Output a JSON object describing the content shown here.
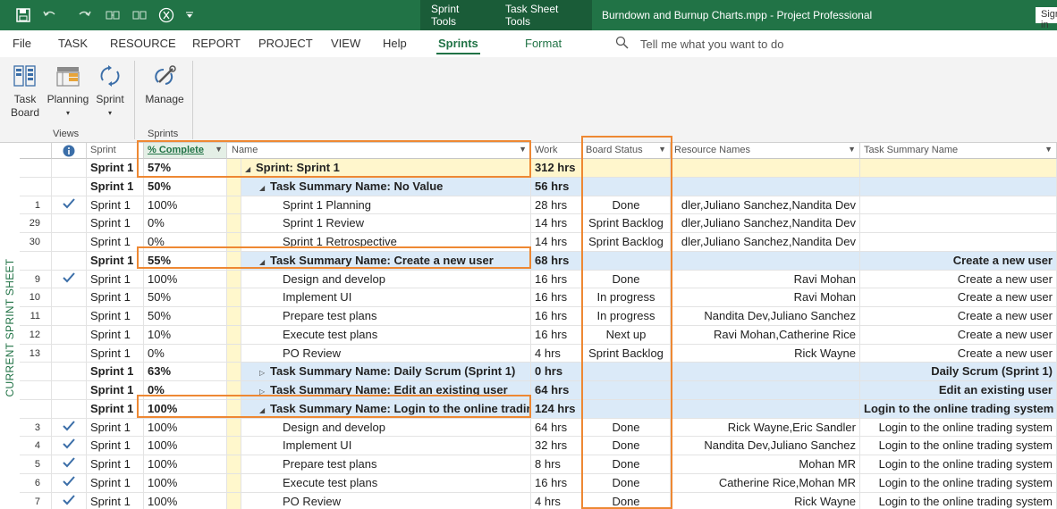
{
  "title_bar": {
    "contextual_tabs": [
      "Sprint Tools",
      "Task Sheet Tools"
    ],
    "document_title": "Burndown and Burnup Charts.mpp  -  Project Professional",
    "sign_in": "Sign in"
  },
  "ribbon_tabs": [
    "File",
    "TASK",
    "RESOURCE",
    "REPORT",
    "PROJECT",
    "VIEW",
    "Help",
    "Sprints",
    "Format"
  ],
  "tell_me": "Tell me what you want to do",
  "ribbon": {
    "views_group": {
      "label": "Views",
      "buttons": [
        "Task Board",
        "Planning",
        "Sprint"
      ]
    },
    "sprints_group": {
      "label": "Sprints",
      "buttons": [
        "Manage"
      ]
    }
  },
  "side_label": "CURRENT SPRINT SHEET",
  "columns": {
    "sprint": "Sprint",
    "pct": "% Complete",
    "name": "Name",
    "work": "Work",
    "board": "Board Status",
    "resources": "Resource Names",
    "tsn": "Task Summary Name"
  },
  "rows": [
    {
      "id": "",
      "check": false,
      "sprint": "Sprint 1",
      "pct": "57%",
      "name": "Sprint: Sprint 1",
      "work": "312 hrs",
      "board": "",
      "res": "",
      "tsn": "",
      "kind": "top",
      "tri": "◢",
      "lvl": 0
    },
    {
      "id": "",
      "check": false,
      "sprint": "Sprint 1",
      "pct": "50%",
      "name": "Task Summary Name: No Value",
      "work": "56 hrs",
      "board": "",
      "res": "",
      "tsn": "",
      "kind": "summary",
      "tri": "◢",
      "lvl": 1
    },
    {
      "id": "1",
      "check": true,
      "sprint": "Sprint 1",
      "pct": "100%",
      "name": "Sprint 1 Planning",
      "work": "28 hrs",
      "board": "Done",
      "res": "dler,Juliano Sanchez,Nandita Dev",
      "tsn": "",
      "kind": "task",
      "tri": "",
      "lvl": 2
    },
    {
      "id": "29",
      "check": false,
      "sprint": "Sprint 1",
      "pct": "0%",
      "name": "Sprint 1 Review",
      "work": "14 hrs",
      "board": "Sprint Backlog",
      "res": "dler,Juliano Sanchez,Nandita Dev",
      "tsn": "",
      "kind": "task",
      "tri": "",
      "lvl": 2
    },
    {
      "id": "30",
      "check": false,
      "sprint": "Sprint 1",
      "pct": "0%",
      "name": "Sprint 1 Retrospective",
      "work": "14 hrs",
      "board": "Sprint Backlog",
      "res": "dler,Juliano Sanchez,Nandita Dev",
      "tsn": "",
      "kind": "task",
      "tri": "",
      "lvl": 2
    },
    {
      "id": "",
      "check": false,
      "sprint": "Sprint 1",
      "pct": "55%",
      "name": "Task Summary Name: Create a new user",
      "work": "68 hrs",
      "board": "",
      "res": "",
      "tsn": "Create a new user",
      "kind": "summary",
      "tri": "◢",
      "lvl": 1
    },
    {
      "id": "9",
      "check": true,
      "sprint": "Sprint 1",
      "pct": "100%",
      "name": "Design and develop",
      "work": "16 hrs",
      "board": "Done",
      "res": "Ravi Mohan",
      "tsn": "Create a new user",
      "kind": "task",
      "tri": "",
      "lvl": 2
    },
    {
      "id": "10",
      "check": false,
      "sprint": "Sprint 1",
      "pct": "50%",
      "name": "Implement UI",
      "work": "16 hrs",
      "board": "In progress",
      "res": "Ravi Mohan",
      "tsn": "Create a new user",
      "kind": "task",
      "tri": "",
      "lvl": 2
    },
    {
      "id": "11",
      "check": false,
      "sprint": "Sprint 1",
      "pct": "50%",
      "name": "Prepare test plans",
      "work": "16 hrs",
      "board": "In progress",
      "res": "Nandita Dev,Juliano Sanchez",
      "tsn": "Create a new user",
      "kind": "task",
      "tri": "",
      "lvl": 2
    },
    {
      "id": "12",
      "check": false,
      "sprint": "Sprint 1",
      "pct": "10%",
      "name": "Execute test plans",
      "work": "16 hrs",
      "board": "Next up",
      "res": "Ravi Mohan,Catherine Rice",
      "tsn": "Create a new user",
      "kind": "task",
      "tri": "",
      "lvl": 2
    },
    {
      "id": "13",
      "check": false,
      "sprint": "Sprint 1",
      "pct": "0%",
      "name": "PO Review",
      "work": "4 hrs",
      "board": "Sprint Backlog",
      "res": "Rick Wayne",
      "tsn": "Create a new user",
      "kind": "task",
      "tri": "",
      "lvl": 2
    },
    {
      "id": "",
      "check": false,
      "sprint": "Sprint 1",
      "pct": "63%",
      "name": "Task Summary Name: Daily Scrum (Sprint 1)",
      "work": "0 hrs",
      "board": "",
      "res": "",
      "tsn": "Daily Scrum (Sprint 1)",
      "kind": "summary",
      "tri": "▷",
      "lvl": 1
    },
    {
      "id": "",
      "check": false,
      "sprint": "Sprint 1",
      "pct": "0%",
      "name": "Task Summary Name: Edit an existing user",
      "work": "64 hrs",
      "board": "",
      "res": "",
      "tsn": "Edit an existing user",
      "kind": "summary",
      "tri": "▷",
      "lvl": 1
    },
    {
      "id": "",
      "check": false,
      "sprint": "Sprint 1",
      "pct": "100%",
      "name": "Task Summary Name: Login to the online trading",
      "work": "124 hrs",
      "board": "",
      "res": "",
      "tsn": "Login to the online trading system",
      "kind": "summary",
      "tri": "◢",
      "lvl": 1
    },
    {
      "id": "3",
      "check": true,
      "sprint": "Sprint 1",
      "pct": "100%",
      "name": "Design and develop",
      "work": "64 hrs",
      "board": "Done",
      "res": "Rick Wayne,Eric Sandler",
      "tsn": "Login to the online trading system",
      "kind": "task",
      "tri": "",
      "lvl": 2
    },
    {
      "id": "4",
      "check": true,
      "sprint": "Sprint 1",
      "pct": "100%",
      "name": "Implement UI",
      "work": "32 hrs",
      "board": "Done",
      "res": "Nandita Dev,Juliano Sanchez",
      "tsn": "Login to the online trading system",
      "kind": "task",
      "tri": "",
      "lvl": 2
    },
    {
      "id": "5",
      "check": true,
      "sprint": "Sprint 1",
      "pct": "100%",
      "name": "Prepare test plans",
      "work": "8 hrs",
      "board": "Done",
      "res": "Mohan MR",
      "tsn": "Login to the online trading system",
      "kind": "task",
      "tri": "",
      "lvl": 2
    },
    {
      "id": "6",
      "check": true,
      "sprint": "Sprint 1",
      "pct": "100%",
      "name": "Execute test plans",
      "work": "16 hrs",
      "board": "Done",
      "res": "Catherine Rice,Mohan MR",
      "tsn": "Login to the online trading system",
      "kind": "task",
      "tri": "",
      "lvl": 2
    },
    {
      "id": "7",
      "check": true,
      "sprint": "Sprint 1",
      "pct": "100%",
      "name": "PO Review",
      "work": "4 hrs",
      "board": "Done",
      "res": "Rick Wayne",
      "tsn": "Login to the online trading system",
      "kind": "task",
      "tri": "",
      "lvl": 2
    }
  ]
}
